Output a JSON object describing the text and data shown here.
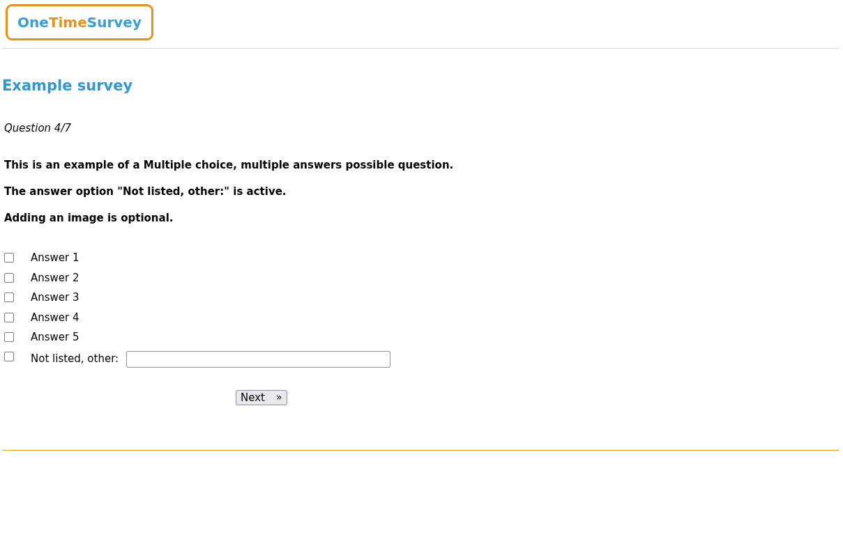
{
  "logo": {
    "parts": [
      {
        "text": "One",
        "color": "#3a9fd5"
      },
      {
        "text": "Time",
        "color": "#e8921e"
      },
      {
        "text": "Survey",
        "color": "#3a9fd5"
      }
    ]
  },
  "survey_title": "Example survey",
  "progress": "Question 4/7",
  "question_lines": [
    "This is an example of a Multiple choice, multiple answers possible question.",
    "The answer option \"Not listed, other:\" is active.",
    "Adding an image is optional."
  ],
  "options": [
    {
      "kind": "plain",
      "label": "Answer 1",
      "checked": false
    },
    {
      "kind": "plain",
      "label": "Answer 2",
      "checked": false
    },
    {
      "kind": "plain",
      "label": "Answer 3",
      "checked": false
    },
    {
      "kind": "plain",
      "label": "Answer 4",
      "checked": false
    },
    {
      "kind": "plain",
      "label": "Answer 5",
      "checked": false
    },
    {
      "kind": "other",
      "label": "Not listed, other:",
      "checked": false
    }
  ],
  "next_button": {
    "label": "Next",
    "arrow": "»"
  }
}
